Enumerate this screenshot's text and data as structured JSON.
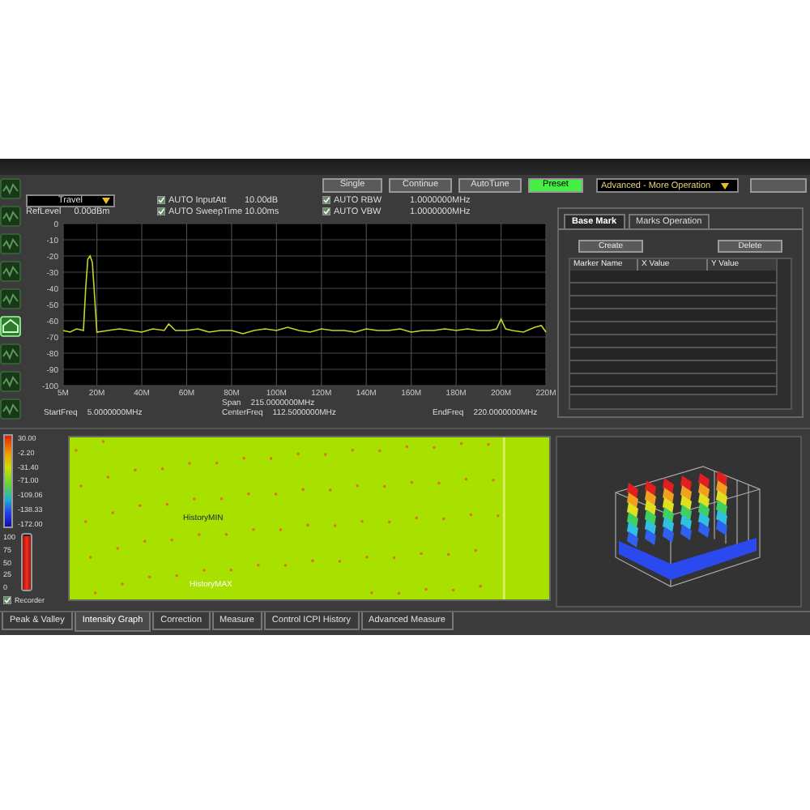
{
  "side_tools": [
    {
      "selected": false
    },
    {
      "selected": false
    },
    {
      "selected": false
    },
    {
      "selected": false
    },
    {
      "selected": false
    },
    {
      "selected": true
    },
    {
      "selected": false
    },
    {
      "selected": false
    },
    {
      "selected": false
    }
  ],
  "controls": {
    "trace_mode": "Travel",
    "ref_level": {
      "label": "RefLevel",
      "value": "0.00dBm"
    },
    "checks": [
      {
        "label": "AUTO InputAtt",
        "value": "10.00dB",
        "checked": true
      },
      {
        "label": "AUTO SweepTime",
        "value": "10.00ms",
        "checked": true
      },
      {
        "label": "AUTO RBW",
        "value": "1.0000000MHz",
        "checked": true
      },
      {
        "label": "AUTO VBW",
        "value": "1.0000000MHz",
        "checked": true
      }
    ],
    "buttons": [
      {
        "label": "Single",
        "selected": false
      },
      {
        "label": "Continue",
        "selected": false
      },
      {
        "label": "AutoTune",
        "selected": false
      },
      {
        "label": "Preset",
        "selected": true
      }
    ],
    "operation": "Advanced - More Operation"
  },
  "spectrum": {
    "chart_data": {
      "type": "line",
      "grid": true,
      "xlim": [
        5,
        220
      ],
      "ylim": [
        -100,
        0
      ],
      "xticks": [
        {
          "value": 5,
          "label": "5M"
        },
        {
          "value": 20,
          "label": "20M"
        },
        {
          "value": 40,
          "label": "40M"
        },
        {
          "value": 60,
          "label": "60M"
        },
        {
          "value": 80,
          "label": "80M"
        },
        {
          "value": 100,
          "label": "100M"
        },
        {
          "value": 120,
          "label": "120M"
        },
        {
          "value": 140,
          "label": "140M"
        },
        {
          "value": 160,
          "label": "160M"
        },
        {
          "value": 180,
          "label": "180M"
        },
        {
          "value": 200,
          "label": "200M"
        },
        {
          "value": 220,
          "label": "220M"
        }
      ],
      "yticks": [
        0,
        -10,
        -20,
        -30,
        -40,
        -50,
        -60,
        -70,
        -80,
        -90,
        -100
      ],
      "x": [
        5,
        8,
        11,
        14,
        15,
        16,
        17,
        18,
        19,
        20,
        25,
        30,
        35,
        40,
        45,
        50,
        52,
        55,
        60,
        65,
        70,
        75,
        80,
        85,
        90,
        95,
        100,
        105,
        110,
        115,
        120,
        125,
        130,
        135,
        140,
        145,
        150,
        155,
        160,
        165,
        170,
        175,
        180,
        185,
        190,
        195,
        198,
        200,
        202,
        205,
        210,
        215,
        218,
        220
      ],
      "series": [
        {
          "color": "#c8d428",
          "values": [
            -66,
            -67,
            -65,
            -66,
            -40,
            -22,
            -20,
            -24,
            -45,
            -67,
            -66,
            -65,
            -66,
            -67,
            -65,
            -66,
            -62,
            -66,
            -66,
            -65,
            -67,
            -66,
            -66,
            -68,
            -66,
            -65,
            -66,
            -64,
            -66,
            -67,
            -65,
            -66,
            -66,
            -67,
            -65,
            -66,
            -66,
            -65,
            -67,
            -66,
            -66,
            -65,
            -66,
            -65,
            -66,
            -66,
            -65,
            -59,
            -65,
            -66,
            -67,
            -64,
            -63,
            -67
          ]
        }
      ]
    },
    "freq_info": [
      {
        "label": "StartFreq",
        "value": "5.0000000MHz"
      },
      {
        "label": "Span",
        "value": "215.0000000MHz"
      },
      {
        "label": "CenterFreq",
        "value": "112.5000000MHz"
      },
      {
        "label": "EndFreq",
        "value": "220.0000000MHz"
      }
    ]
  },
  "markers": {
    "tabs": [
      {
        "label": "Base Mark",
        "selected": true
      },
      {
        "label": "Marks Operation",
        "selected": false
      }
    ],
    "buttons": [
      "Create",
      "Delete"
    ],
    "columns": [
      "Marker Name",
      "X Value",
      "Y Value"
    ]
  },
  "intensity": {
    "scale": [
      "30.00",
      "-2.20",
      "-31.40",
      "-71.00",
      "-109.06",
      "-138.33",
      "-172.00"
    ],
    "buffer": {
      "ticks": [
        "100",
        "75",
        "50",
        "25",
        "0"
      ],
      "level": 0.97
    },
    "recorder": {
      "label": "Recorder",
      "checked": true
    },
    "labels": [
      "HistoryMIN",
      "HistoryMAX"
    ]
  },
  "bottom_tabs": [
    {
      "label": "Peak & Valley",
      "selected": false
    },
    {
      "label": "Intensity Graph",
      "selected": true
    },
    {
      "label": "Correction",
      "selected": false
    },
    {
      "label": "Measure",
      "selected": false
    },
    {
      "label": "Control ICPI History",
      "selected": false
    },
    {
      "label": "Advanced Measure",
      "selected": false
    }
  ]
}
